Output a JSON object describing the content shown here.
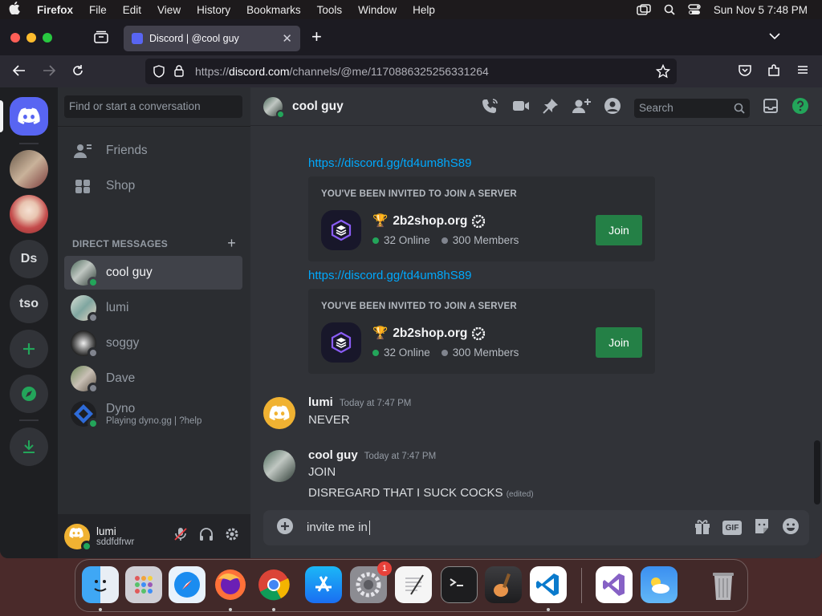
{
  "menubar": {
    "app": "Firefox",
    "items": [
      "File",
      "Edit",
      "View",
      "History",
      "Bookmarks",
      "Tools",
      "Window",
      "Help"
    ],
    "clock": "Sun Nov 5  7:48 PM"
  },
  "browser": {
    "tab_title": "Discord | @cool guy",
    "url_prefix": "https://",
    "url_host": "discord.com",
    "url_path": "/channels/@me/1170886325256331264"
  },
  "servers": {
    "items": [
      {
        "label": "Ds"
      },
      {
        "label": "tso"
      }
    ]
  },
  "sidebar": {
    "search_placeholder": "Find or start a conversation",
    "friends_label": "Friends",
    "shop_label": "Shop",
    "dm_header": "DIRECT MESSAGES",
    "dms": [
      {
        "name": "cool guy",
        "status": "online"
      },
      {
        "name": "lumi",
        "status": "offline"
      },
      {
        "name": "soggy",
        "status": "offline"
      },
      {
        "name": "Dave",
        "status": "offline"
      },
      {
        "name": "Dyno",
        "subtitle": "Playing dyno.gg | ?help",
        "status": "online"
      }
    ]
  },
  "user_panel": {
    "name": "lumi",
    "tag": "sddfdfrwr"
  },
  "chat": {
    "title": "cool guy",
    "search_placeholder": "Search",
    "invites": [
      {
        "link": "https://discord.gg/td4um8hS89",
        "label": "YOU'VE BEEN INVITED TO JOIN A SERVER",
        "server_emoji": "🏆",
        "server_name": "2b2shop.org",
        "online": "32 Online",
        "members": "300 Members",
        "join_label": "Join"
      },
      {
        "link": "https://discord.gg/td4um8hS89",
        "label": "YOU'VE BEEN INVITED TO JOIN A SERVER",
        "server_emoji": "🏆",
        "server_name": "2b2shop.org",
        "online": "32 Online",
        "members": "300 Members",
        "join_label": "Join"
      }
    ],
    "messages": [
      {
        "author": "lumi",
        "time": "Today at 7:47 PM",
        "lines": [
          "NEVER"
        ]
      },
      {
        "author": "cool guy",
        "time": "Today at 7:47 PM",
        "lines": [
          "JOIN",
          "DISREGARD THAT I SUCK COCKS"
        ],
        "edited": "(edited)"
      }
    ],
    "composer_value": "invite me in",
    "gif_label": "GIF"
  },
  "dock": {
    "settings_badge": "1"
  },
  "colors": {
    "blurple": "#5865f2",
    "online": "#23a55a",
    "link": "#00a8fc",
    "join_button": "#248046"
  }
}
